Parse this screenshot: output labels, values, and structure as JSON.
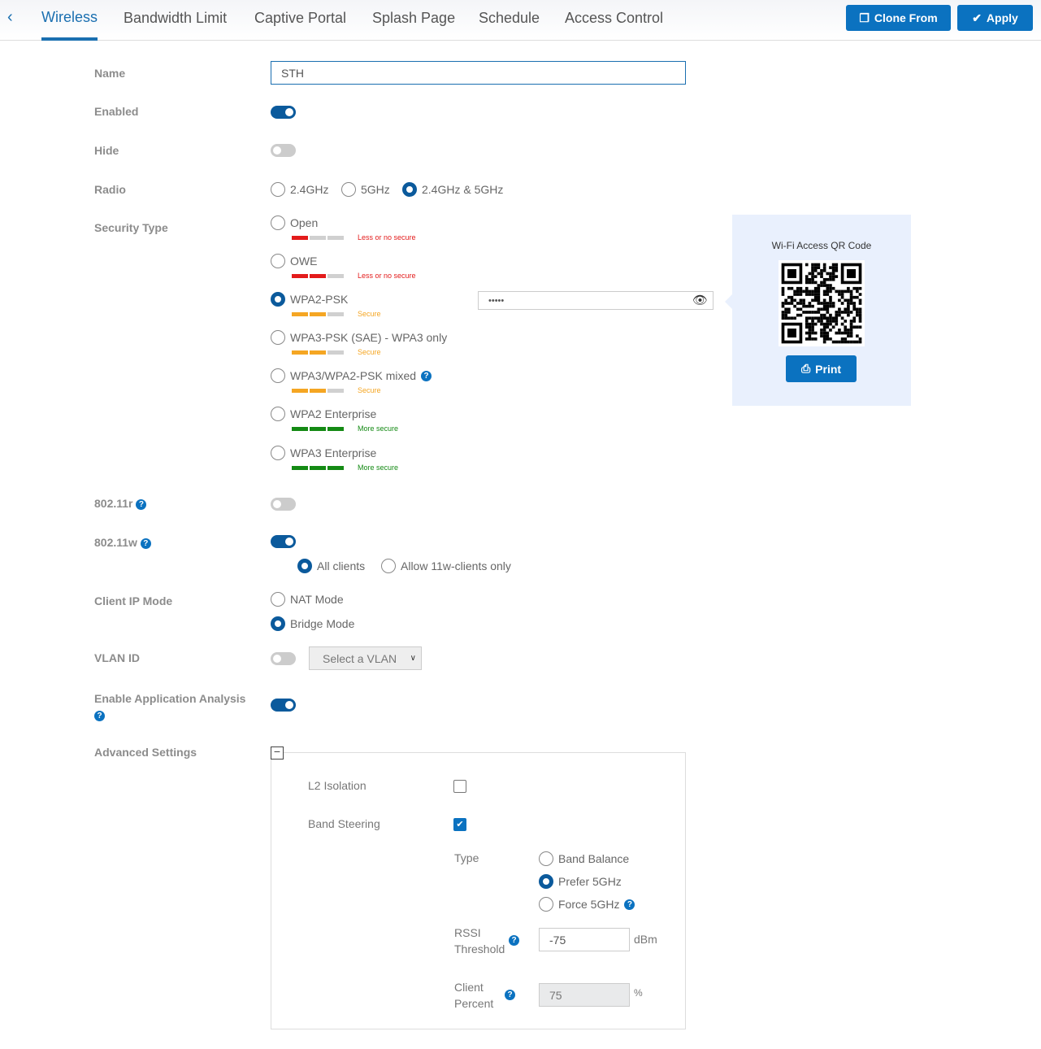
{
  "tabs": [
    {
      "label": "Wireless"
    },
    {
      "label": "Bandwidth Limit"
    },
    {
      "label": "Captive Portal"
    },
    {
      "label": "Splash Page"
    },
    {
      "label": "Schedule"
    },
    {
      "label": "Access Control"
    }
  ],
  "buttons": {
    "clone": "Clone From",
    "apply": "Apply",
    "print": "Print"
  },
  "labels": {
    "name": "Name",
    "enabled": "Enabled",
    "hide": "Hide",
    "radio": "Radio",
    "security": "Security Type",
    "r80211r": "802.11r",
    "r80211w": "802.11w",
    "client_ip": "Client IP Mode",
    "vlan": "VLAN ID",
    "app_analysis": "Enable Application Analysis",
    "advanced": "Advanced Settings"
  },
  "name_value": "STH",
  "toggles": {
    "enabled": true,
    "hide": false,
    "r80211r": false,
    "r80211w": true,
    "vlan": false,
    "app_analysis": true
  },
  "radio_options": [
    "2.4GHz",
    "5GHz",
    "2.4GHz & 5GHz"
  ],
  "radio_selected": "2.4GHz & 5GHz",
  "security_types": [
    {
      "label": "Open",
      "strength": 1,
      "level": "Less or no secure",
      "color": "#e31b1b"
    },
    {
      "label": "OWE",
      "strength": 2,
      "level": "Less or no secure",
      "color": "#e31b1b"
    },
    {
      "label": "WPA2-PSK",
      "strength": 2,
      "level": "Secure",
      "color": "#f5a623",
      "selected": true
    },
    {
      "label": "WPA3-PSK (SAE) - WPA3 only",
      "strength": 2,
      "level": "Secure",
      "color": "#f5a623"
    },
    {
      "label": "WPA3/WPA2-PSK mixed",
      "strength": 2,
      "level": "Secure",
      "color": "#f5a623"
    },
    {
      "label": "WPA2 Enterprise",
      "strength": 3,
      "level": "More secure",
      "color": "#148a14"
    },
    {
      "label": "WPA3 Enterprise",
      "strength": 3,
      "level": "More secure",
      "color": "#148a14"
    }
  ],
  "password_mask": "•••••",
  "qr": {
    "title": "Wi-Fi Access QR Code"
  },
  "w_options": [
    "All clients",
    "Allow 11w-clients only"
  ],
  "ip_modes": [
    "NAT Mode",
    "Bridge Mode"
  ],
  "vlan_select": "Select a VLAN",
  "advanced": {
    "l2_isolation": "L2 Isolation",
    "band_steering": "Band Steering",
    "type": "Type",
    "type_options": [
      "Band Balance",
      "Prefer 5GHz",
      "Force 5GHz"
    ],
    "rssi_label_1": "RSSI",
    "rssi_label_2": "Threshold",
    "rssi_value": "-75",
    "rssi_unit": "dBm",
    "client_label_1": "Client",
    "client_label_2": "Percent",
    "client_value": "75",
    "client_unit": "%"
  }
}
